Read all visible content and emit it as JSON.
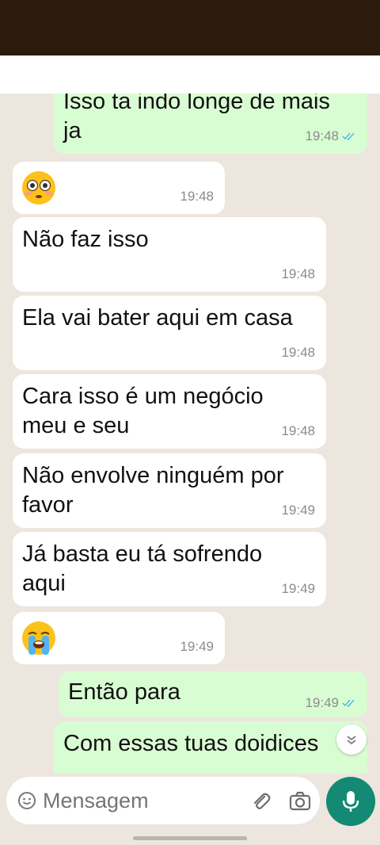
{
  "composer": {
    "placeholder": "Mensagem"
  },
  "messages": [
    {
      "dir": "out",
      "lines": [
        "Isso ta indo longe de mais",
        "ja"
      ],
      "time": "19:48",
      "read": true
    },
    {
      "dir": "in",
      "emoji": "flushed-face",
      "time": "19:48"
    },
    {
      "dir": "in",
      "lines": [
        "Não faz isso"
      ],
      "time": "19:48"
    },
    {
      "dir": "in",
      "lines": [
        "Ela vai bater aqui em casa"
      ],
      "time": "19:48"
    },
    {
      "dir": "in",
      "lines": [
        "Cara isso é um negócio",
        "meu e seu"
      ],
      "time": "19:48"
    },
    {
      "dir": "in",
      "lines": [
        "Não envolve ninguém por",
        "favor"
      ],
      "time": "19:49"
    },
    {
      "dir": "in",
      "lines": [
        "Já basta eu tá sofrendo",
        "aqui"
      ],
      "time": "19:49"
    },
    {
      "dir": "in",
      "emoji": "loudly-crying-face",
      "time": "19:49"
    },
    {
      "dir": "out",
      "lines": [
        "Então para"
      ],
      "time": "19:49",
      "read": true
    },
    {
      "dir": "out",
      "lines": [
        "Com essas tuas doidices"
      ],
      "time": "",
      "read": false
    }
  ],
  "colors": {
    "incoming_bubble": "#ffffff",
    "outgoing_bubble": "#d9fdd3",
    "read_tick": "#53bdeb",
    "mic_button": "#148a74"
  },
  "icons": [
    "smile-icon",
    "attach-icon",
    "camera-icon",
    "mic-icon",
    "chevron-down-icon",
    "double-tick-icon"
  ]
}
